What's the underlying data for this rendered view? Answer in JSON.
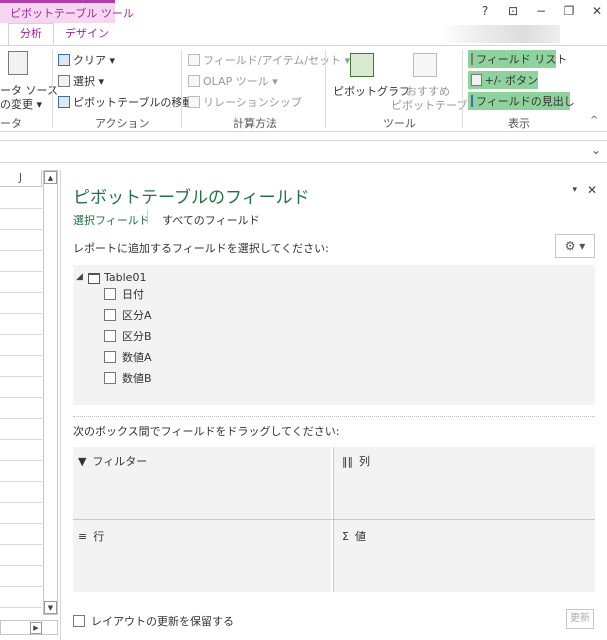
{
  "title_bar": {
    "context_tab": "ピボットテーブル ツール",
    "tabs": [
      "分析",
      "デザイン"
    ],
    "window_controls": [
      "?",
      "⊡",
      "−",
      "❐",
      "✕"
    ]
  },
  "ribbon": {
    "partial_group": {
      "line1": "ータ ソース",
      "line2": "の変更 ▾",
      "label": "ータ"
    },
    "action_group": {
      "label": "アクション",
      "items": [
        "クリア ▾",
        "選択 ▾",
        "ピボットテーブルの移動"
      ]
    },
    "calc_group": {
      "label": "計算方法",
      "items": [
        "フィールド/アイテム/セット ▾",
        "OLAP ツール ▾",
        "リレーションシップ"
      ]
    },
    "tools_group": {
      "label": "ツール",
      "pivotchart": "ピボットグラフ",
      "recommended_line1": "おすすめ",
      "recommended_line2": "ピボットテーブル"
    },
    "show_group": {
      "label": "表示",
      "items": [
        "フィールド リスト",
        "+/- ボタン",
        "フィールドの見出し"
      ]
    },
    "collapse": "^"
  },
  "formula_bar": {
    "chevron": "⌄"
  },
  "grid": {
    "column_header": "J"
  },
  "pane": {
    "title": "ピボットテーブルのフィールド",
    "menu_chevron": "▾",
    "close": "✕",
    "tabs": {
      "selected": "選択フィールド",
      "all": "すべてのフィールド"
    },
    "instruction": "レポートに追加するフィールドを選択してください:",
    "gear": "⚙ ▾",
    "table": {
      "toggle": "◢",
      "name": "Table01"
    },
    "fields": [
      "日付",
      "区分A",
      "区分B",
      "数値A",
      "数値B"
    ],
    "drag_instruction": "次のボックス間でフィールドをドラッグしてください:",
    "areas": {
      "filter": {
        "icon": "▼",
        "label": "フィルター"
      },
      "columns": {
        "icon": "‖‖",
        "label": "列"
      },
      "rows": {
        "icon": "≡",
        "label": "行"
      },
      "values": {
        "icon": "Σ",
        "label": "値"
      }
    },
    "defer_label": "レイアウトの更新を保留する",
    "update_button": "更新"
  },
  "colors": {
    "accent_green": "#217346",
    "context_pink": "#a4259b",
    "highlight_green": "#8fd39c"
  }
}
